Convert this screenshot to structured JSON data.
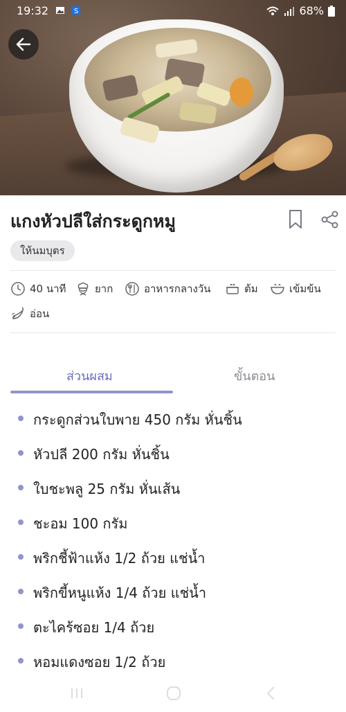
{
  "status_bar": {
    "time": "19:32",
    "battery": "68%"
  },
  "recipe": {
    "title": "แกงหัวปลีใส่กระดูกหมู",
    "badge": "ให้นมบุตร",
    "meta": {
      "time": "40 นาที",
      "difficulty": "ยาก",
      "meal": "อาหารกลางวัน",
      "method": "ต้ม",
      "texture": "เข้มข้น",
      "spice": "อ่อน"
    }
  },
  "tabs": {
    "ingredients": "ส่วนผสม",
    "steps": "ขั้นตอน"
  },
  "ingredients": [
    "กระดูกส่วนใบพาย 450 กรัม หั่นชิ้น",
    "หัวปลี 200 กรัม หั่นชิ้น",
    "ใบชะพลู 25 กรัม หั่นเส้น",
    "ชะอม 100 กรัม",
    "พริกชี้ฟ้าแห้ง 1/2 ถ้วย แช่น้ำ",
    "พริกขี้หนูแห้ง 1/4 ถ้วย แช่น้ำ",
    "ตะไคร้ซอย 1/4 ถ้วย",
    "หอมแดงซอย 1/2 ถ้วย"
  ],
  "colors": {
    "accent": "#8f95cc",
    "accent_text": "#6a6fba"
  }
}
